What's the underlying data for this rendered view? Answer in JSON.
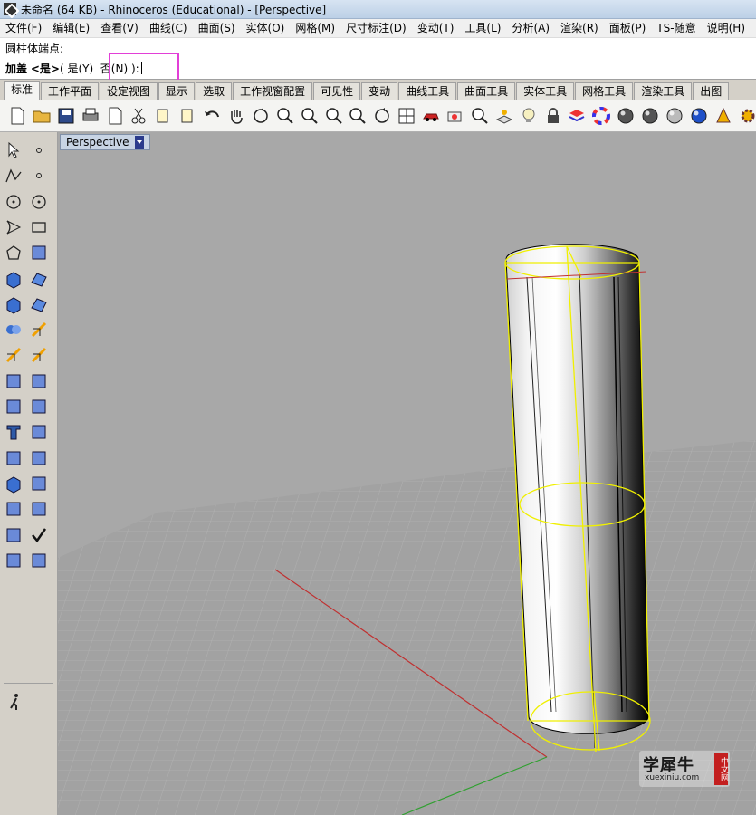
{
  "window": {
    "title": "未命名 (64 KB) - Rhinoceros (Educational) - [Perspective]"
  },
  "menu": [
    "文件(F)",
    "编辑(E)",
    "查看(V)",
    "曲线(C)",
    "曲面(S)",
    "实体(O)",
    "网格(M)",
    "尺寸标注(D)",
    "变动(T)",
    "工具(L)",
    "分析(A)",
    "渲染(R)",
    "面板(P)",
    "TS-随意",
    "说明(H)"
  ],
  "command": {
    "history": "圆柱体端点:",
    "prompt_label": "加盖",
    "prompt_default": "<是>",
    "prompt_options": "( 是(Y)  否(N) ):"
  },
  "tabs": [
    "标准",
    "工作平面",
    "设定视图",
    "显示",
    "选取",
    "工作视窗配置",
    "可见性",
    "变动",
    "曲线工具",
    "曲面工具",
    "实体工具",
    "网格工具",
    "渲染工具",
    "出图"
  ],
  "active_tab_index": 0,
  "toolbar_icons": [
    "new-file-icon",
    "open-folder-icon",
    "save-icon",
    "print-icon",
    "import-icon",
    "cut-icon",
    "copy-icon",
    "paste-icon",
    "undo-icon",
    "pan-hand-icon",
    "rotate-view-icon",
    "zoom-window-icon",
    "zoom-dynamic-icon",
    "zoom-extents-icon",
    "zoom-selected-icon",
    "rotate-camera-icon",
    "four-viewports-icon",
    "car-icon",
    "camera-icon",
    "target-icon",
    "cplane-icon",
    "bulb-icon",
    "lock-icon",
    "layer-stack-icon",
    "color-wheel-icon",
    "shaded-sphere-icon",
    "rendered-sphere-icon",
    "ghosted-sphere-icon",
    "blue-sphere-icon",
    "cone-icon",
    "gear-icon"
  ],
  "sidebar_icons": [
    "select-arrow-icon",
    "point-icon",
    "polyline-icon",
    "curve-points-icon",
    "circle-icon",
    "ellipse-icon",
    "arc-icon",
    "rectangle-icon",
    "polygon-icon",
    "fillet-curve-icon",
    "box-solid-icon",
    "loft-surface-icon",
    "cylinder-solid-icon",
    "surface-patch-icon",
    "boolean-icon",
    "explode-icon",
    "trim-icon",
    "split-icon",
    "group-icon",
    "ungroup-icon",
    "offset-curve-icon",
    "blend-curve-icon",
    "text-icon",
    "scale-icon",
    "array-icon",
    "orient-icon",
    "box-edit-icon",
    "dimension-icon",
    "grid-array-icon",
    "distance-icon",
    "gumball-icon",
    "check-icon",
    "shade-icon",
    "render-icon",
    "walk-icon"
  ],
  "viewport": {
    "label": "Perspective"
  },
  "watermark": {
    "main": "学犀牛",
    "sub": "xuexiniu.com",
    "badge": "中文网"
  },
  "colors": {
    "highlight": "#e23fd7",
    "selection": "#f0f000",
    "x_axis": "#c03030",
    "y_axis": "#30a030",
    "viewport_bg": "#a8a8a8"
  }
}
